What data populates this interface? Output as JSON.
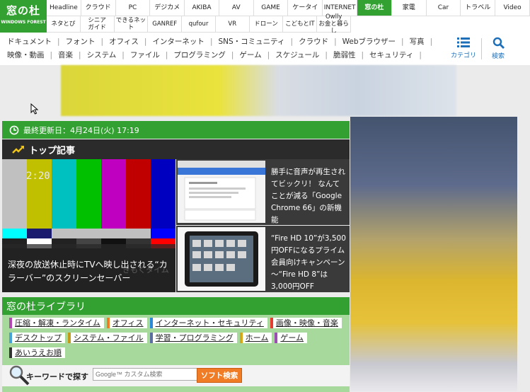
{
  "network": {
    "logo_main": "窓の杜",
    "logo_sub": "WINDOWS FOREST",
    "row1": [
      "Headline",
      "クラウド",
      "PC",
      "デジカメ",
      "AKIBA",
      "AV",
      "GAME",
      "ケータイ",
      "INTERNET",
      "窓の杜",
      "家電",
      "Car",
      "トラベル",
      "Video"
    ],
    "row2": [
      "ネタとぴ",
      "シニア\nガイド",
      "できるネット",
      "GANREF",
      "qufour",
      "VR",
      "ドローン",
      "こどもとIT",
      "Owlly\nお金と暮らし"
    ],
    "active": "窓の杜",
    "accent": "#33a132"
  },
  "categories": {
    "row1": [
      "ドキュメント",
      "フォント",
      "オフィス",
      "インターネット",
      "SNS・コミュニティ",
      "クラウド",
      "Webブラウザー",
      "写真"
    ],
    "row2": [
      "映像・動画",
      "音楽",
      "システム",
      "ファイル",
      "プログラミング",
      "ゲーム",
      "スケジュール",
      "脆弱性",
      "セキュリティ"
    ],
    "menu_label": "カテゴリ",
    "search_label": "検索"
  },
  "updated": {
    "text": "最終更新日：4月24日(火) 17:19"
  },
  "top_articles": {
    "heading": "トップ記事",
    "feature": {
      "clock": "2:20",
      "caption": "深夜の放送休止時にTVへ映し出される“カラーバー”のスクリーンセーバー",
      "watermark": "きもくタイム"
    },
    "articles": [
      {
        "text": "勝手に音声が再生されてビックリ！ なんてことが減る「Google Chrome 66」の新機能"
      },
      {
        "text": "“Fire HD 10”が3,500円OFFになるプライム会員向けキャンペーン～“Fire HD 8”は3,000円OFF"
      }
    ]
  },
  "library": {
    "heading": "窓の杜ライブラリ",
    "tags": [
      {
        "label": "圧縮・解凍・ランタイム",
        "color": "#b347b4"
      },
      {
        "label": "オフィス",
        "color": "#f07d25"
      },
      {
        "label": "インターネット・セキュリティ",
        "color": "#2b8ad8"
      },
      {
        "label": "画像・映像・音楽",
        "color": "#e43c2e"
      },
      {
        "label": "デスクトップ",
        "color": "#46a3d8"
      },
      {
        "label": "システム・ファイル",
        "color": "#c49a1a"
      },
      {
        "label": "学習・プログラミング",
        "color": "#5a6fa0"
      },
      {
        "label": "ホーム",
        "color": "#d6a61b"
      },
      {
        "label": "ゲーム",
        "color": "#9b4db0"
      },
      {
        "label": "あいうえお順",
        "color": "#333333"
      }
    ],
    "keyword_label": "キーワードで探す",
    "search_placeholder": "Google™ カスタム検索",
    "search_button": "ソフト検索"
  }
}
